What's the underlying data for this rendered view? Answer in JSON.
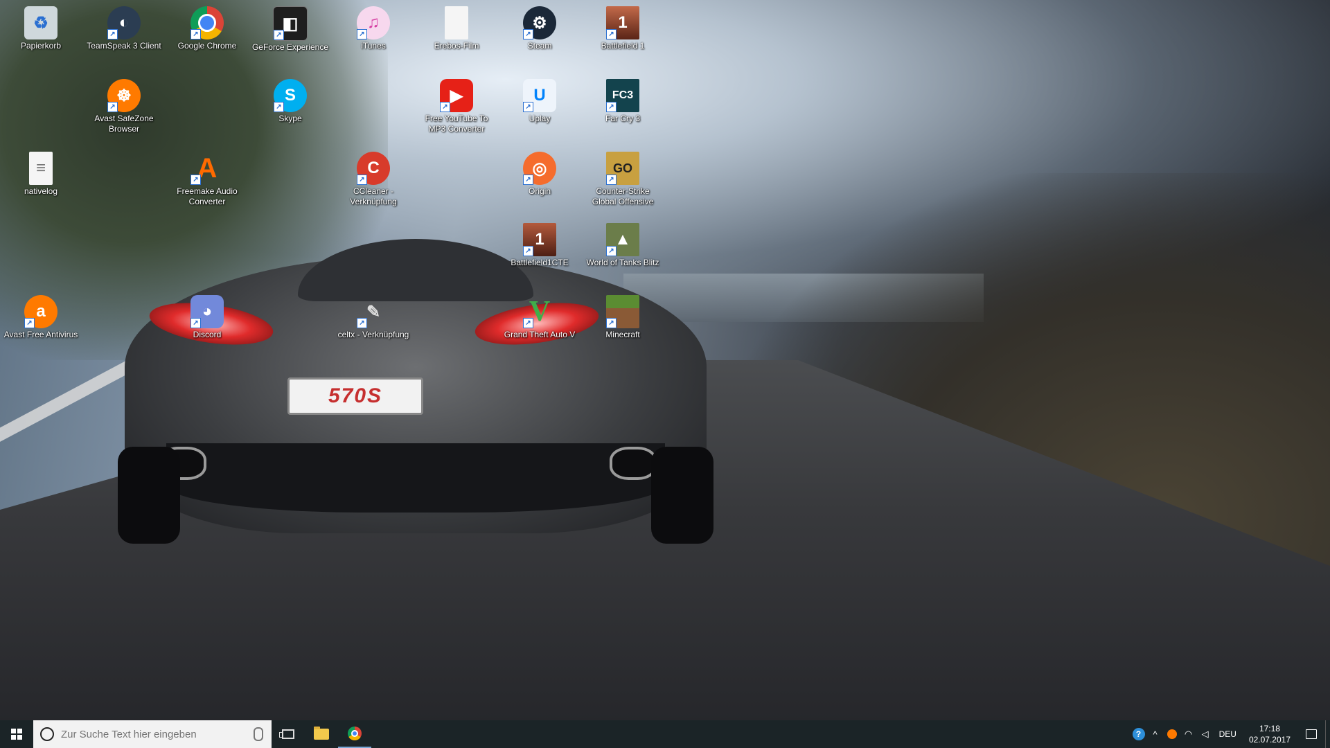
{
  "desktop_icons": [
    {
      "label": "Papierkorb",
      "icon": "recycle-bin-icon",
      "color": "#cfd8dc",
      "glyph": "♻"
    },
    {
      "label": "TeamSpeak 3 Client",
      "icon": "teamspeak-icon",
      "color": "#2b3d52",
      "glyph": "◐"
    },
    {
      "label": "Google Chrome",
      "icon": "chrome-icon",
      "color": "#4285f4",
      "glyph": "◉"
    },
    {
      "label": "GeForce Experience",
      "icon": "geforce-icon",
      "color": "#1e1e1e",
      "glyph": "◧"
    },
    {
      "label": "iTunes",
      "icon": "itunes-icon",
      "color": "#f7d8ee",
      "glyph": "♫"
    },
    {
      "label": "Erebos-Film",
      "icon": "document-icon",
      "color": "#f5f5f5",
      "glyph": ""
    },
    {
      "label": "Steam",
      "icon": "steam-icon",
      "color": "#1b2838",
      "glyph": "⚙"
    },
    {
      "label": "Battlefield 1",
      "icon": "battlefield-icon",
      "color": "#a0412c",
      "glyph": "1"
    },
    {
      "label": "Avast SafeZone Browser",
      "icon": "avast-safezone-icon",
      "color": "#ff7a00",
      "glyph": "☸"
    },
    {
      "label": "Skype",
      "icon": "skype-icon",
      "color": "#00aff0",
      "glyph": "S"
    },
    {
      "label": "Free YouTube To MP3 Converter",
      "icon": "youtube-mp3-icon",
      "color": "#e62117",
      "glyph": "▶"
    },
    {
      "label": "Uplay",
      "icon": "uplay-icon",
      "color": "#0082fb",
      "glyph": "U"
    },
    {
      "label": "Far Cry 3",
      "icon": "farcry3-icon",
      "color": "#13434d",
      "glyph": "FC3"
    },
    {
      "label": "nativelog",
      "icon": "text-file-icon",
      "color": "#f5f5f5",
      "glyph": "≡"
    },
    {
      "label": "Freemake Audio Converter",
      "icon": "freemake-icon",
      "color": "#ff6a00",
      "glyph": "A"
    },
    {
      "label": "CCleaner - Verknüpfung",
      "icon": "ccleaner-icon",
      "color": "#d83b2b",
      "glyph": "C"
    },
    {
      "label": "Origin",
      "icon": "origin-icon",
      "color": "#f56c2d",
      "glyph": "◎"
    },
    {
      "label": "Counter-Strike Global Offensive",
      "icon": "csgo-icon",
      "color": "#c8a040",
      "glyph": "GO"
    },
    {
      "label": "Battlefield1CTE",
      "icon": "battlefield-cte-icon",
      "color": "#8f3a27",
      "glyph": "1"
    },
    {
      "label": "World of Tanks Blitz",
      "icon": "wot-blitz-icon",
      "color": "#6b7d4a",
      "glyph": "▲"
    },
    {
      "label": "Avast Free Antivirus",
      "icon": "avast-icon",
      "color": "#ff7a00",
      "glyph": "a"
    },
    {
      "label": "Discord",
      "icon": "discord-icon",
      "color": "#7289da",
      "glyph": "◕"
    },
    {
      "label": "celtx - Verknüpfung",
      "icon": "celtx-icon",
      "color": "#555555",
      "glyph": "✎"
    },
    {
      "label": "Grand Theft Auto V",
      "icon": "gta5-icon",
      "color": "#2f8f3a",
      "glyph": "V"
    },
    {
      "label": "Minecraft",
      "icon": "minecraft-icon",
      "color": "#5b8c32",
      "glyph": "▦"
    }
  ],
  "wallpaper": {
    "plate_text": "570S"
  },
  "taskbar": {
    "search_placeholder": "Zur Suche Text hier eingeben",
    "language": "DEU",
    "time": "17:18",
    "date": "02.07.2017",
    "help_glyph": "?",
    "tray_chevron": "^"
  },
  "colors": {
    "taskbar": "#1b2427",
    "accent": "#7aa7d6"
  }
}
